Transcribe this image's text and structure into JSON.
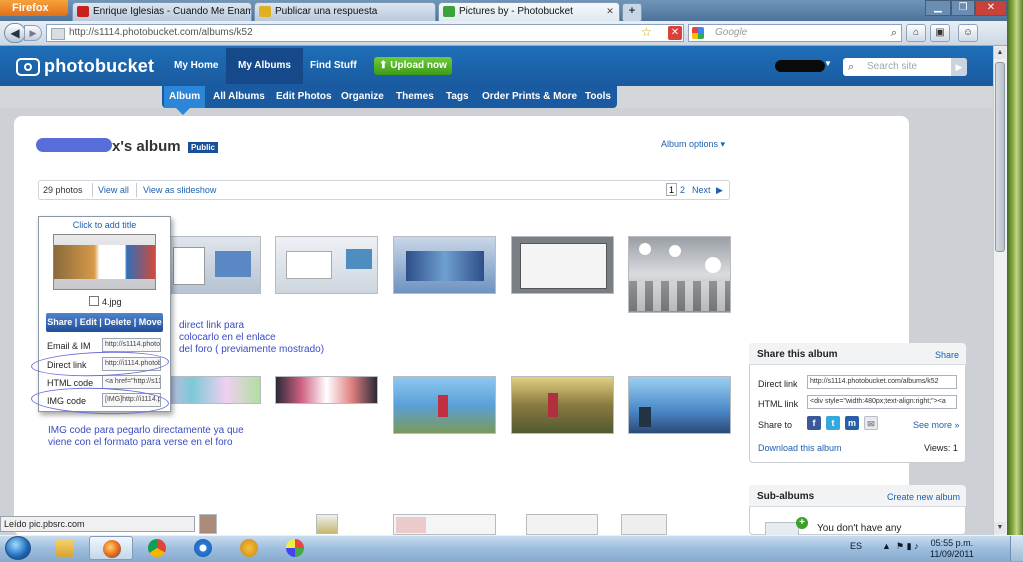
{
  "browser": {
    "app_button": "Firefox",
    "tabs": [
      {
        "label": "Enrique Iglesias - Cuando Me Enamo...",
        "icon": "youtube-icon",
        "color": "#c8201c"
      },
      {
        "label": "Publicar una respuesta",
        "icon": "forum-icon",
        "color": "#e0b020"
      },
      {
        "label": "Pictures by             - Photobucket",
        "icon": "photobucket-icon",
        "color": "#3aa33a"
      }
    ],
    "new_tab": "+",
    "url": "http://s1114.photobucket.com/albums/k52",
    "search_engine": "Google",
    "search_placeholder": "Google"
  },
  "photobucket": {
    "logo": "photobucket",
    "nav": [
      "My Home",
      "My Albums",
      "Find Stuff"
    ],
    "upload_button": "Upload now",
    "search_placeholder": "Search site",
    "subnav": [
      "Album",
      "All Albums",
      "Edit Photos",
      "Organize",
      "Themes",
      "Tags",
      "Order Prints & More",
      "Tools"
    ]
  },
  "album": {
    "title_suffix": "x's album",
    "badge": "Public",
    "options": "Album options ▾",
    "photo_count": "29 photos",
    "view_all": "View all",
    "slideshow": "View as slideshow",
    "page_current": "1",
    "page_next_num": "2",
    "next": "Next"
  },
  "photo_card": {
    "add_title": "Click to add title",
    "filename": "4.jpg",
    "actions": "Share | Edit | Delete | Move",
    "rows": [
      {
        "label": "Email & IM",
        "value": "http://s1114.photob"
      },
      {
        "label": "Direct link",
        "value": "http://i1114.photob"
      },
      {
        "label": "HTML code",
        "value": "<a href=\"http://s111"
      },
      {
        "label": "IMG code",
        "value": "[IMG]http://i1114.pl"
      }
    ]
  },
  "annotations": {
    "direct_link": [
      "direct link para",
      "colocarlo en el enlace",
      "del foro ( previamente mostrado)"
    ],
    "img_code": [
      "IMG code para pegarlo directamente ya que",
      "viene con el formato para verse en el foro"
    ]
  },
  "share_album": {
    "title": "Share this album",
    "share_link": "Share",
    "direct_label": "Direct link",
    "direct_value": "http://s1114.photobucket.com/albums/k52",
    "html_label": "HTML link",
    "html_value": "<div style=\"width:480px;text-align:right;\"><a",
    "share_to": "Share to",
    "see_more": "See more »",
    "download": "Download this album",
    "views": "Views: 1"
  },
  "sub_albums": {
    "title": "Sub-albums",
    "create": "Create new album",
    "empty": "You don't have any"
  },
  "status_bar": "Leído pic.pbsrc.com",
  "taskbar": {
    "language": "ES",
    "time": "05:55 p.m.",
    "date": "11/09/2011"
  }
}
